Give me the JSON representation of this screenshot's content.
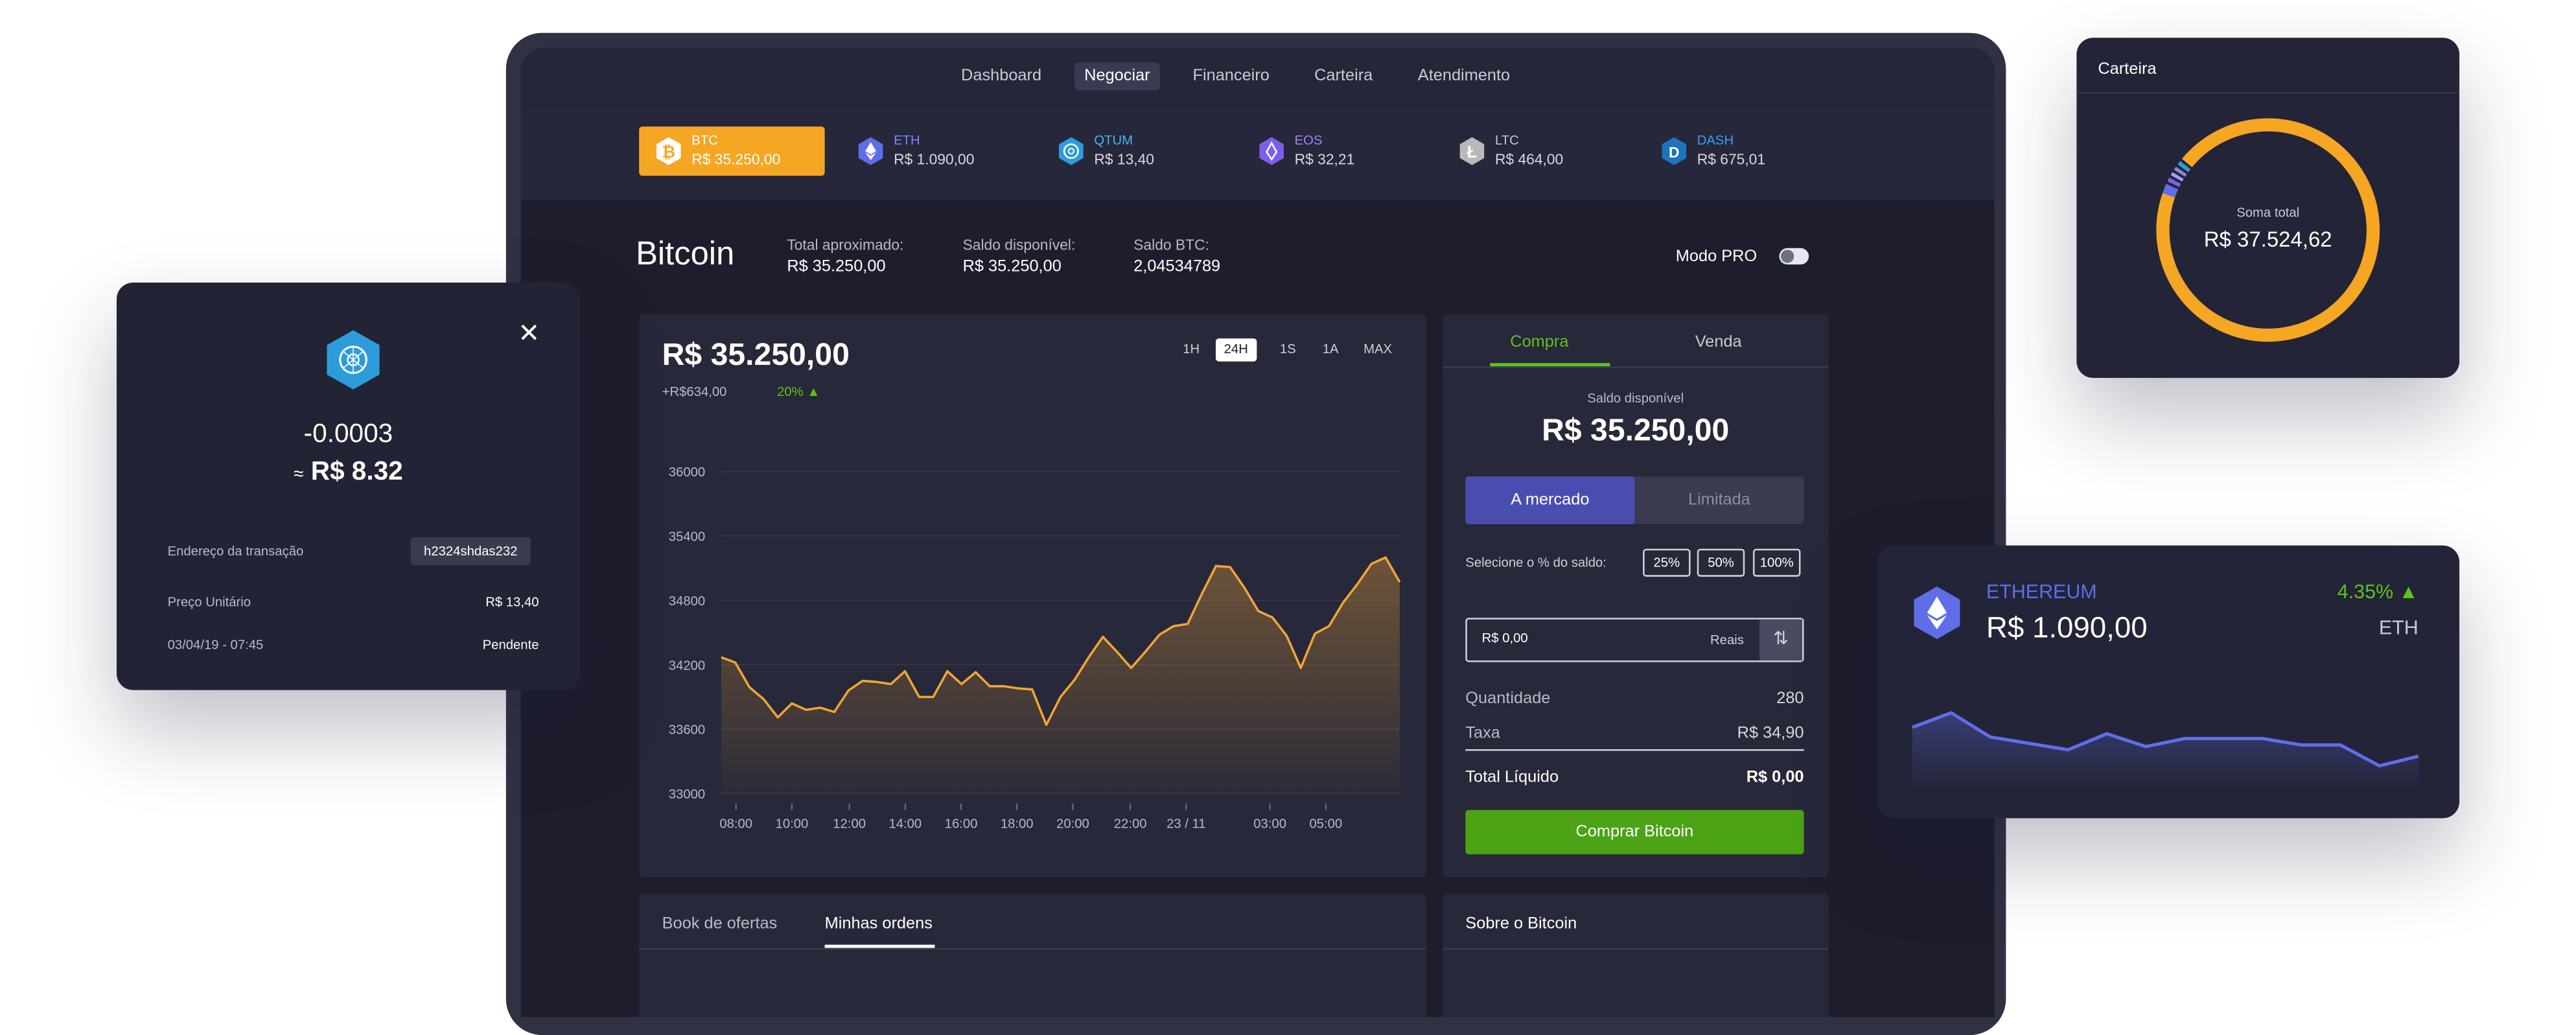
{
  "nav": {
    "items": [
      "Dashboard",
      "Negociar",
      "Financeiro",
      "Carteira",
      "Atendimento"
    ],
    "active": 1
  },
  "coins": [
    {
      "symbol": "BTC",
      "price": "R$ 35.250,00",
      "icon": "bitcoin-icon",
      "color": "#f5a623"
    },
    {
      "symbol": "ETH",
      "price": "R$ 1.090,00",
      "icon": "ethereum-icon",
      "color": "#5f6ee8"
    },
    {
      "symbol": "QTUM",
      "price": "R$ 13,40",
      "icon": "qtum-icon",
      "color": "#2d9cdb"
    },
    {
      "symbol": "EOS",
      "price": "R$ 32,21",
      "icon": "eos-icon",
      "color": "#7b5fe8"
    },
    {
      "symbol": "LTC",
      "price": "R$ 464,00",
      "icon": "litecoin-icon",
      "color": "#8a8a8a"
    },
    {
      "symbol": "DASH",
      "price": "R$ 675,01",
      "icon": "dash-icon",
      "color": "#1c75bc"
    }
  ],
  "summary": {
    "title": "Bitcoin",
    "total_label": "Total aproximado:",
    "total_value": "R$ 35.250,00",
    "saldo_label": "Saldo disponível:",
    "saldo_value": "R$ 35.250,00",
    "btc_label": "Saldo BTC:",
    "btc_value": "2,04534789",
    "modo_pro": "Modo PRO"
  },
  "chart_panel": {
    "price": "R$ 35.250,00",
    "change": "+R$634,00",
    "change_pct": "20%",
    "timeframes": [
      "1H",
      "24H",
      "1S",
      "1A",
      "MAX"
    ],
    "active_timeframe": 1
  },
  "chart_data": {
    "type": "area",
    "y_ticks": [
      "36000",
      "35400",
      "34800",
      "34200",
      "33600",
      "33000"
    ],
    "ylim": [
      33000,
      36000
    ],
    "x_ticks": [
      "08:00",
      "10:00",
      "12:00",
      "14:00",
      "16:00",
      "18:00",
      "20:00",
      "22:00",
      "23 / 11",
      "03:00",
      "05:00"
    ],
    "series": [
      {
        "values": [
          34270,
          34220,
          33990,
          33880,
          33710,
          33840,
          33780,
          33800,
          33760,
          33960,
          34050,
          34040,
          34020,
          34140,
          33900,
          33900,
          34140,
          34020,
          34130,
          34000,
          34000,
          33980,
          33970,
          33640,
          33900,
          34060,
          34270,
          34460,
          34320,
          34170,
          34320,
          34480,
          34560,
          34580,
          34860,
          35120,
          35110,
          34920,
          34700,
          34640,
          34470,
          34170,
          34490,
          34560,
          34780,
          34950,
          35140,
          35200,
          34970
        ],
        "color": "#f0a536"
      }
    ]
  },
  "order": {
    "tabs": [
      "Compra",
      "Venda"
    ],
    "saldo_label": "Saldo disponível",
    "saldo_value": "R$ 35.250,00",
    "modes": [
      "A mercado",
      "Limitada"
    ],
    "pct_label": "Selecione o % do saldo:",
    "pcts": [
      "25%",
      "50%",
      "100%"
    ],
    "amount_value": "R$ 0,00",
    "amount_unit": "Reais",
    "qty_label": "Quantidade",
    "qty_value": "280",
    "taxa_label": "Taxa",
    "taxa_value": "R$ 34,90",
    "total_label": "Total Líquido",
    "total_value": "R$ 0,00",
    "buy_button": "Comprar Bitcoin"
  },
  "bottom": {
    "tabs": [
      "Book de ofertas",
      "Minhas ordens"
    ],
    "about": "Sobre o Bitcoin"
  },
  "transaction": {
    "amount": "-0.0003",
    "approx_symbol": "≈",
    "fiat": "R$ 8.32",
    "rows": [
      {
        "label": "Endereço da transação",
        "value": "h2324shdas232"
      },
      {
        "label": "Preço Unitário",
        "value": "R$ 13,40"
      },
      {
        "label": "03/04/19 - 07:45",
        "value": "Pendente"
      }
    ]
  },
  "wallet": {
    "title": "Carteira",
    "label": "Soma total",
    "value": "R$ 37.524,62",
    "donut": [
      {
        "value": 93.5,
        "color": "#f5a623"
      },
      {
        "value": 1.8,
        "color": "#5f6ee8"
      },
      {
        "value": 1.0,
        "color": "#7b5fe8"
      },
      {
        "value": 0.9,
        "color": "#9aa0ff"
      },
      {
        "value": 0.9,
        "color": "#8a8acb"
      },
      {
        "value": 1.0,
        "color": "#2d9cdb"
      }
    ]
  },
  "ethereum": {
    "name": "ETHEREUM",
    "price": "R$ 1.090,00",
    "change": "4.35%",
    "symbol": "ETH",
    "spark": [
      1105,
      1114,
      1099,
      1095,
      1091,
      1101,
      1093,
      1098,
      1098,
      1098,
      1094,
      1094,
      1081,
      1087
    ],
    "color": "#5f6ee8"
  }
}
